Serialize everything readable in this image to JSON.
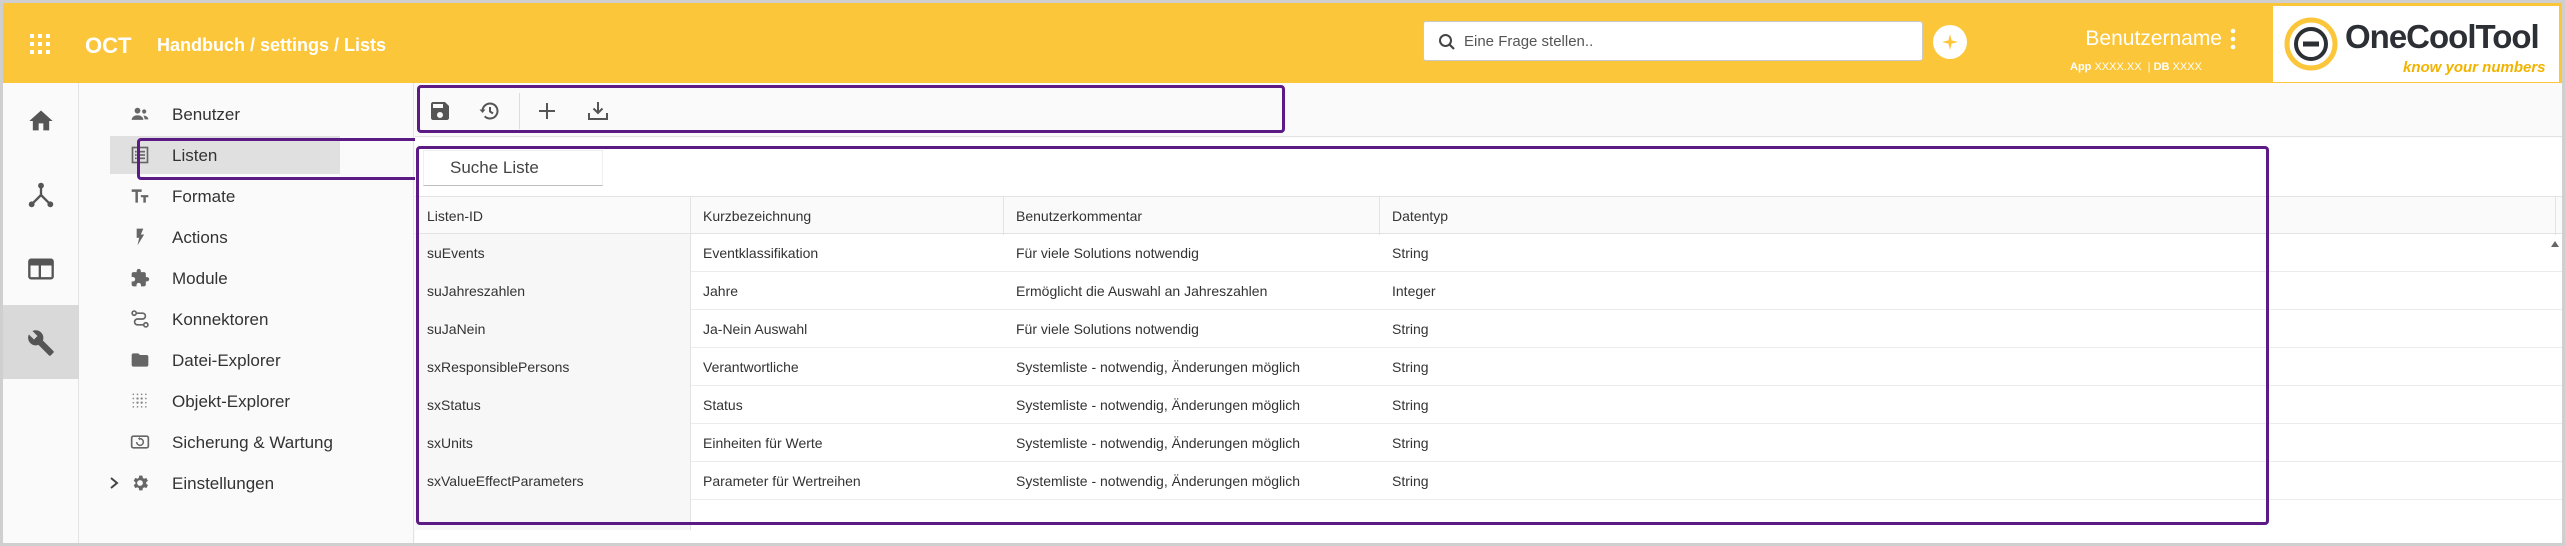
{
  "header": {
    "app_name": "OCT",
    "breadcrumb": "Handbuch / settings / Lists",
    "search_placeholder": "Eine Frage stellen..",
    "username": "Benutzername",
    "app_label": "App",
    "app_version": "XXXX.XX",
    "db_label": "DB",
    "db_version": "XXXX",
    "logo_text": "OneCoolTool",
    "logo_tagline": "know your numbers"
  },
  "rail": {
    "items": [
      {
        "icon": "home-icon"
      },
      {
        "icon": "network-icon"
      },
      {
        "icon": "window-icon"
      },
      {
        "icon": "wrench-icon",
        "active": true
      }
    ]
  },
  "sidebar": {
    "items": [
      {
        "label": "Benutzer",
        "icon": "users-icon"
      },
      {
        "label": "Listen",
        "icon": "list-icon",
        "active": true
      },
      {
        "label": "Formate",
        "icon": "text-format-icon"
      },
      {
        "label": "Actions",
        "icon": "bolt-icon"
      },
      {
        "label": "Module",
        "icon": "puzzle-icon"
      },
      {
        "label": "Konnektoren",
        "icon": "connector-icon"
      },
      {
        "label": "Datei-Explorer",
        "icon": "folder-icon"
      },
      {
        "label": "Objekt-Explorer",
        "icon": "dots-grid-icon"
      },
      {
        "label": "Sicherung & Wartung",
        "icon": "backup-icon"
      },
      {
        "label": "Einstellungen",
        "icon": "gear-icon"
      }
    ]
  },
  "toolbar": {
    "buttons": [
      "save-icon",
      "restore-icon",
      "add-icon",
      "download-icon"
    ]
  },
  "list": {
    "search_placeholder": "Suche Liste",
    "columns": [
      "Listen-ID",
      "Kurzbezeichnung",
      "Benutzerkommentar",
      "Datentyp"
    ],
    "rows": [
      [
        "suEvents",
        "Eventklassifikation",
        "Für viele Solutions notwendig",
        "String"
      ],
      [
        "suJahreszahlen",
        "Jahre",
        "Ermöglicht die Auswahl an Jahreszahlen",
        "Integer"
      ],
      [
        "suJaNein",
        "Ja-Nein Auswahl",
        "Für viele Solutions notwendig",
        "String"
      ],
      [
        "sxResponsiblePersons",
        "Verantwortliche",
        "Systemliste - notwendig, Änderungen möglich",
        "String"
      ],
      [
        "sxStatus",
        "Status",
        "Systemliste - notwendig, Änderungen möglich",
        "String"
      ],
      [
        "sxUnits",
        "Einheiten für Werte",
        "Systemliste - notwendig, Änderungen möglich",
        "String"
      ],
      [
        "sxValueEffectParameters",
        "Parameter für Wertreihen",
        "Systemliste - notwendig, Änderungen möglich",
        "String"
      ]
    ]
  },
  "colors": {
    "header_bg": "#fcc63b",
    "highlight": "#5b1a84",
    "logo_accent": "#f2b300"
  }
}
